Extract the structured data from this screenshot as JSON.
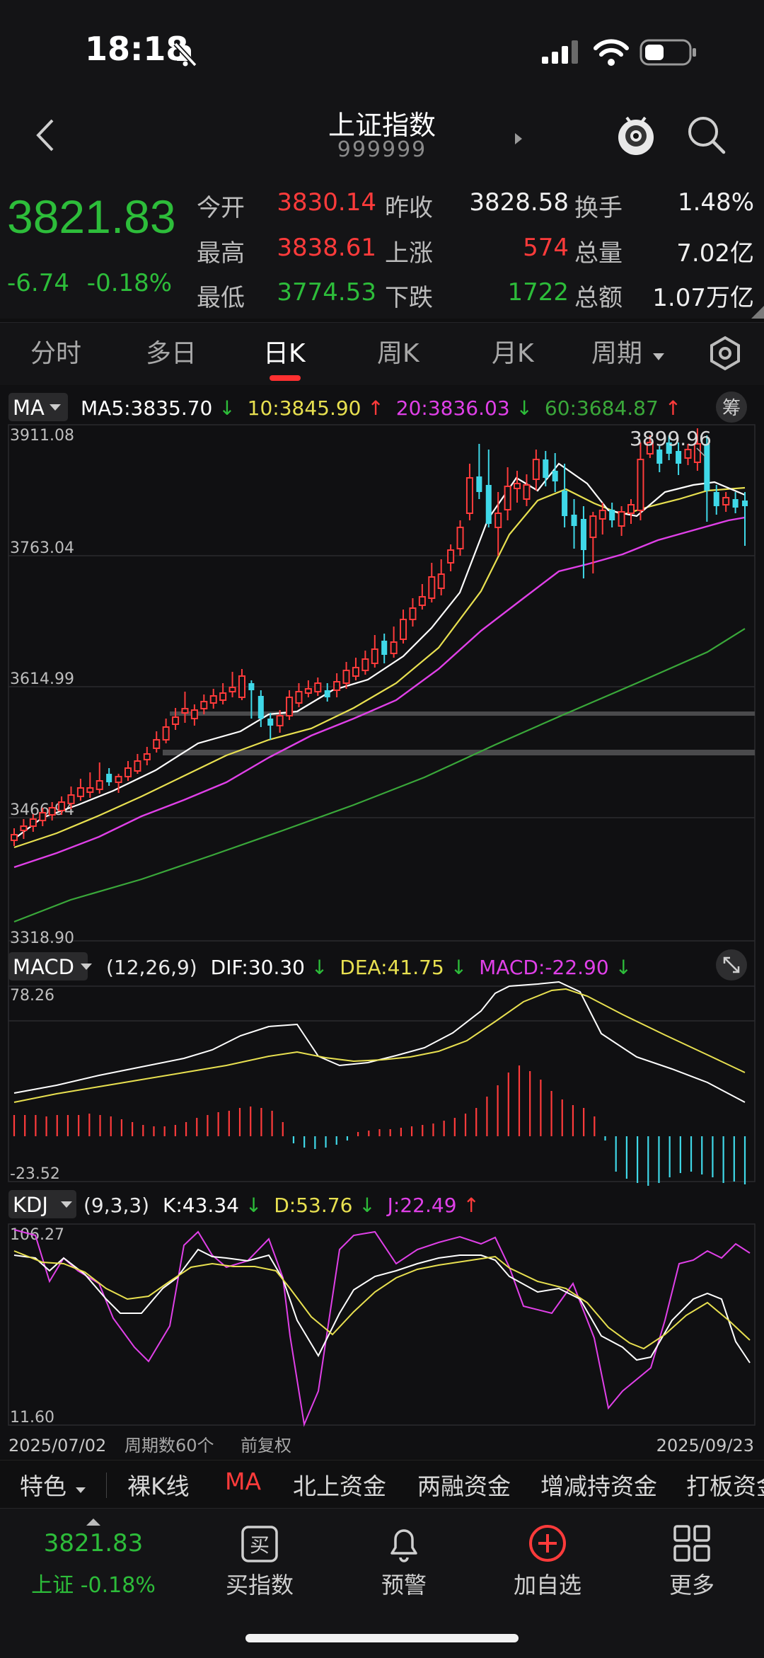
{
  "status": {
    "time": "18:18"
  },
  "nav": {
    "title": "上证指数",
    "code": "999999"
  },
  "quote": {
    "price": "3821.83",
    "change": "-6.74",
    "change_pct": "-0.18%",
    "open_label": "今开",
    "open": "3830.14",
    "prev_close_label": "昨收",
    "prev_close": "3828.58",
    "turnover_label": "换手",
    "turnover": "1.48%",
    "high_label": "最高",
    "high": "3838.61",
    "up_label": "上涨",
    "up": "574",
    "volume_label": "总量",
    "volume": "7.02亿",
    "low_label": "最低",
    "low": "3774.53",
    "down_label": "下跌",
    "down": "1722",
    "amount_label": "总额",
    "amount": "1.07万亿"
  },
  "tabs": {
    "intraday": "分时",
    "multiday": "多日",
    "daily": "日K",
    "weekly": "周K",
    "monthly": "月K",
    "period": "周期"
  },
  "ma": {
    "selector": "MA",
    "ma5": "MA5:3835.70",
    "ma5_arrow": "↓",
    "ma10": "10:3845.90",
    "ma10_arrow": "↑",
    "ma20": "20:3836.03",
    "ma20_arrow": "↓",
    "ma60": "60:3684.87",
    "ma60_arrow": "↑",
    "chip_button": "筹"
  },
  "price_axis": {
    "top": "3911.08",
    "l2": "3763.04",
    "l3": "3614.99",
    "l4": "3466.94",
    "bottom": "3318.90"
  },
  "high_annotation": "3899.96",
  "macd": {
    "selector": "MACD",
    "params": "(12,26,9)",
    "dif": "DIF:30.30",
    "dif_arrow": "↓",
    "dea": "DEA:41.75",
    "dea_arrow": "↓",
    "macd": "MACD:-22.90",
    "macd_arrow": "↓",
    "axis_top": "78.26",
    "axis_bottom": "-23.52"
  },
  "kdj": {
    "selector": "KDJ",
    "params": "(9,3,3)",
    "k": "K:43.34",
    "k_arrow": "↓",
    "d": "D:53.76",
    "d_arrow": "↓",
    "j": "J:22.49",
    "j_arrow": "↑",
    "axis_top": "106.27",
    "axis_bottom": "11.60"
  },
  "footer": {
    "start_date": "2025/07/02",
    "period_count": "周期数60个",
    "adjust": "前复权",
    "end_date": "2025/09/23"
  },
  "features": [
    "特色",
    "裸K线",
    "MA",
    "北上资金",
    "两融资金",
    "增减持资金",
    "打板资金"
  ],
  "bottom": {
    "index_price": "3821.83",
    "index_label": "上证 -0.18%",
    "buy": "买指数",
    "alert": "预警",
    "add": "加自选",
    "more": "更多"
  },
  "colors": {
    "up": "#ff3b3b",
    "down": "#3fd8e8",
    "green": "#2dbd3a",
    "ma5": "#ffffff",
    "ma10": "#e8e050",
    "ma20": "#e040e8",
    "ma60": "#3aa83a"
  }
}
